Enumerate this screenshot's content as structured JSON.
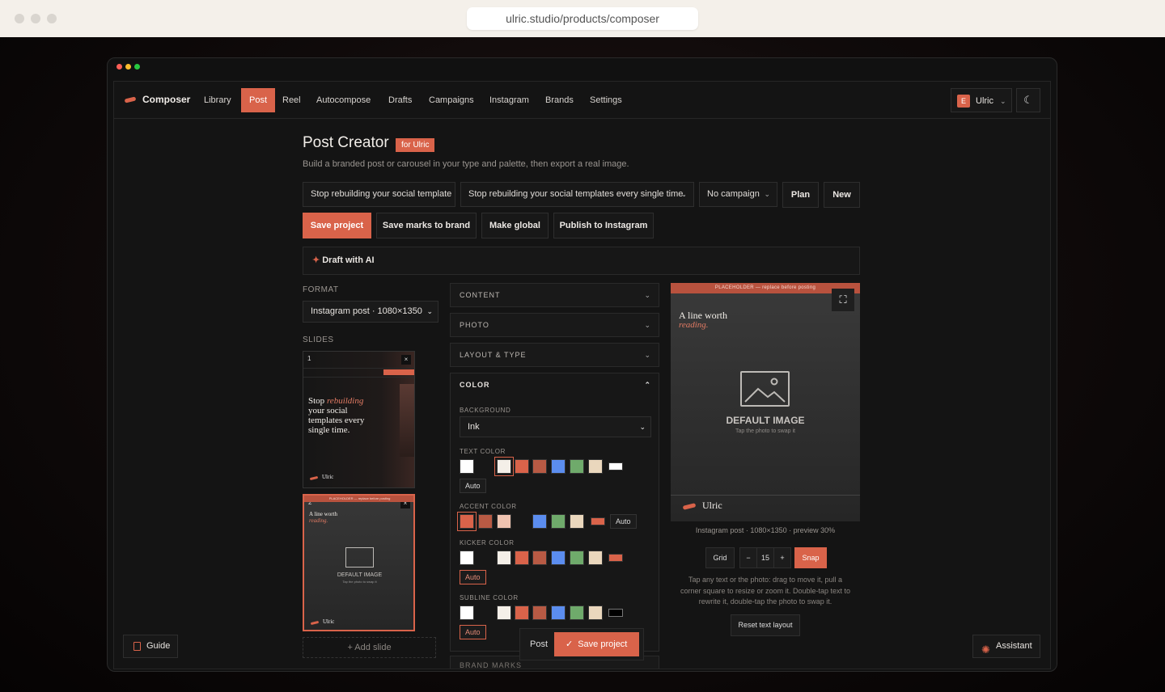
{
  "browser": {
    "url": "ulric.studio/products/composer"
  },
  "nav": {
    "brand": "Composer",
    "items": [
      "Library",
      "Post",
      "Reel",
      "Autocompose",
      "Drafts",
      "Campaigns",
      "Instagram",
      "Brands",
      "Settings"
    ],
    "active": "Post",
    "user_initial": "E",
    "user_name": "Ulric"
  },
  "header": {
    "title": "Post Creator",
    "badge": "for Ulric",
    "subtitle": "Build a branded post or carousel in your type and palette, then export a real image."
  },
  "toolbar": {
    "title_input_value": "Stop rebuilding your social template",
    "template_select": "Stop rebuilding your social templates every single time.",
    "campaign_select": "No campaign",
    "plan": "Plan",
    "new": "New",
    "save_project": "Save project",
    "save_marks": "Save marks to brand",
    "make_global": "Make global",
    "publish": "Publish to Instagram"
  },
  "ai": {
    "label": "Draft with AI"
  },
  "format": {
    "label": "FORMAT",
    "value": "Instagram post · 1080×1350"
  },
  "slides": {
    "label": "SLIDES",
    "items": [
      {
        "number": "1",
        "headline_start": "Stop",
        "headline_accent": "rebuilding",
        "headline_rest": "your social templates every single time.",
        "brand": "Ulric"
      },
      {
        "number": "2",
        "banner": "PLACEHOLDER — replace before posting",
        "headline": "A line worth",
        "accent": "reading.",
        "image_label": "DEFAULT IMAGE",
        "image_hint": "Tap the photo to swap it",
        "brand": "Ulric"
      }
    ],
    "add": "+ Add slide"
  },
  "sections": {
    "content": "CONTENT",
    "photo": "PHOTO",
    "layout": "LAYOUT & TYPE",
    "color": "COLOR",
    "brand_marks": "BRAND MARKS"
  },
  "color": {
    "background_label": "BACKGROUND",
    "background_value": "Ink",
    "text_label": "TEXT COLOR",
    "accent_label": "ACCENT COLOR",
    "kicker_label": "KICKER COLOR",
    "subline_label": "SUBLINE COLOR",
    "auto": "Auto",
    "palette": {
      "white": "#ffffff",
      "cream": "#f4efe8",
      "coral": "#d9634a",
      "rust": "#b85a44",
      "blush": "#efc3b0",
      "blue": "#5b8def",
      "green": "#6faa6b",
      "sand": "#ead7bd",
      "black": "#000000"
    }
  },
  "preview": {
    "banner": "PLACEHOLDER — replace before posting",
    "headline": "A line worth",
    "accent": "reading.",
    "image_label": "DEFAULT IMAGE",
    "image_hint": "Tap the photo to swap it",
    "brand": "Ulric",
    "caption": "Instagram post · 1080×1350 · preview 30%",
    "grid": "Grid",
    "minus": "−",
    "grid_size": "15",
    "plus": "+",
    "snap": "Snap",
    "help": "Tap any text or the photo: drag to move it, pull a corner square to resize or zoom it. Double-tap text to rewrite it, double-tap the photo to swap it.",
    "reset": "Reset text layout"
  },
  "floating": {
    "post": "Post",
    "save": "Save project",
    "check": "✓"
  },
  "footer": {
    "guide": "Guide",
    "assistant": "Assistant"
  },
  "theme": {
    "accent": "#d9634a",
    "background": "#141414"
  }
}
